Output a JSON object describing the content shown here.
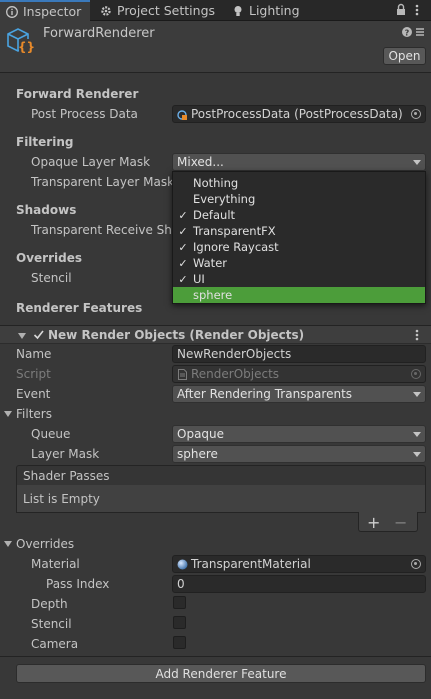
{
  "tabs": [
    {
      "label": "Inspector",
      "icon": "info-icon",
      "active": true
    },
    {
      "label": "Project Settings",
      "icon": "gear-icon",
      "active": false
    },
    {
      "label": "Lighting",
      "icon": "bulb-icon",
      "active": false
    }
  ],
  "header": {
    "title": "ForwardRenderer",
    "open_label": "Open"
  },
  "forward_renderer": {
    "section": "Forward Renderer",
    "post_process_label": "Post Process Data",
    "post_process_value": "PostProcessData (PostProcessData)",
    "filtering_label": "Filtering",
    "opaque_label": "Opaque Layer Mask",
    "opaque_value": "Mixed...",
    "transparent_label": "Transparent Layer Mask",
    "shadows_label": "Shadows",
    "transparent_receive_label": "Transparent Receive Sha",
    "overrides_label": "Overrides",
    "stencil_label": "Stencil",
    "renderer_features_label": "Renderer Features"
  },
  "layer_popup": {
    "items": [
      {
        "label": "Nothing",
        "checked": false,
        "selected": false
      },
      {
        "label": "Everything",
        "checked": false,
        "selected": false
      },
      {
        "label": "Default",
        "checked": true,
        "selected": false
      },
      {
        "label": "TransparentFX",
        "checked": true,
        "selected": false
      },
      {
        "label": "Ignore Raycast",
        "checked": true,
        "selected": false
      },
      {
        "label": "Water",
        "checked": true,
        "selected": false
      },
      {
        "label": "UI",
        "checked": true,
        "selected": false
      },
      {
        "label": "sphere",
        "checked": false,
        "selected": true
      }
    ],
    "check_glyph": "✓"
  },
  "feature": {
    "title": "New Render Objects (Render Objects)",
    "enabled": true,
    "name_label": "Name",
    "name_value": "NewRenderObjects",
    "script_label": "Script",
    "script_value": "RenderObjects",
    "event_label": "Event",
    "event_value": "After Rendering Transparents",
    "filters_label": "Filters",
    "queue_label": "Queue",
    "queue_value": "Opaque",
    "layer_mask_label": "Layer Mask",
    "layer_mask_value": "sphere",
    "shader_passes_label": "Shader Passes",
    "list_empty_label": "List is Empty",
    "plus": "+",
    "minus": "−",
    "overrides_label": "Overrides",
    "material_label": "Material",
    "material_value": "TransparentMaterial",
    "pass_index_label": "Pass Index",
    "pass_index_value": "0",
    "depth_label": "Depth",
    "stencil_label": "Stencil",
    "camera_label": "Camera"
  },
  "add_feature_label": "Add Renderer Feature",
  "colors": {
    "accent_blue": "#3a79bb",
    "selected_green": "#4c9d3a",
    "asset_orange": "#e88a2a"
  }
}
